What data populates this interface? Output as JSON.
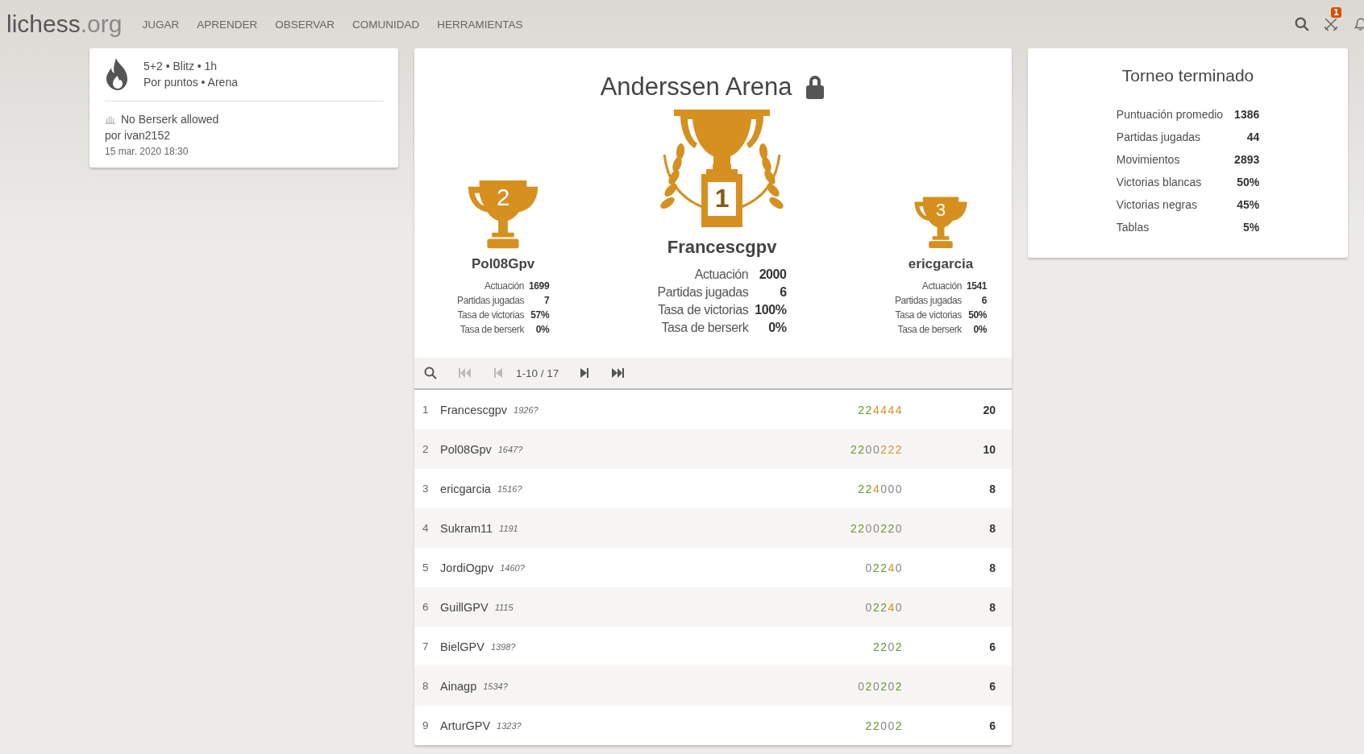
{
  "header": {
    "logo_main": "lichess",
    "logo_tld": ".org",
    "nav": [
      "JUGAR",
      "APRENDER",
      "OBSERVAR",
      "COMUNIDAD",
      "HERRAMIENTAS"
    ],
    "challenge_badge": "1"
  },
  "info": {
    "line1": "5+2 • Blitz • 1h",
    "line2": "Por puntos • Arena",
    "note": "No Berserk allowed",
    "author": "por ivan2152",
    "date": "15 mar. 2020 18:30"
  },
  "tournament": {
    "title": "Anderssen Arena",
    "locked": true
  },
  "podium": [
    {
      "place": "2",
      "name": "Pol08Gpv",
      "stats": [
        [
          "Actuación",
          "1699"
        ],
        [
          "Partidas jugadas",
          "7"
        ],
        [
          "Tasa de victorias",
          "57%"
        ],
        [
          "Tasa de berserk",
          "0%"
        ]
      ]
    },
    {
      "place": "1",
      "name": "Francescgpv",
      "stats": [
        [
          "Actuación",
          "2000"
        ],
        [
          "Partidas jugadas",
          "6"
        ],
        [
          "Tasa de victorias",
          "100%"
        ],
        [
          "Tasa de berserk",
          "0%"
        ]
      ]
    },
    {
      "place": "3",
      "name": "ericgarcia",
      "stats": [
        [
          "Actuación",
          "1541"
        ],
        [
          "Partidas jugadas",
          "6"
        ],
        [
          "Tasa de victorias",
          "50%"
        ],
        [
          "Tasa de berserk",
          "0%"
        ]
      ]
    }
  ],
  "pager": {
    "range": "1-10 / 17"
  },
  "standings": [
    {
      "rank": "1",
      "name": "Francescgpv",
      "rating": "1926?",
      "sheet": [
        {
          "d": "2",
          "kind": "win"
        },
        {
          "d": "2",
          "kind": "win"
        },
        {
          "d": "4",
          "kind": "streak"
        },
        {
          "d": "4",
          "kind": "streak"
        },
        {
          "d": "4",
          "kind": "streak"
        },
        {
          "d": "4",
          "kind": "streak"
        }
      ],
      "score": "20"
    },
    {
      "rank": "2",
      "name": "Pol08Gpv",
      "rating": "1647?",
      "sheet": [
        {
          "d": "2",
          "kind": "win"
        },
        {
          "d": "2",
          "kind": "win"
        },
        {
          "d": "0",
          "kind": "loss"
        },
        {
          "d": "0",
          "kind": "loss"
        },
        {
          "d": "2",
          "kind": "streak"
        },
        {
          "d": "2",
          "kind": "streak"
        },
        {
          "d": "2",
          "kind": "streak"
        }
      ],
      "score": "10"
    },
    {
      "rank": "3",
      "name": "ericgarcia",
      "rating": "1516?",
      "sheet": [
        {
          "d": "2",
          "kind": "win"
        },
        {
          "d": "2",
          "kind": "win"
        },
        {
          "d": "4",
          "kind": "streak"
        },
        {
          "d": "0",
          "kind": "loss"
        },
        {
          "d": "0",
          "kind": "loss"
        },
        {
          "d": "0",
          "kind": "loss"
        }
      ],
      "score": "8"
    },
    {
      "rank": "4",
      "name": "Sukram11",
      "rating": "1191",
      "sheet": [
        {
          "d": "2",
          "kind": "win"
        },
        {
          "d": "2",
          "kind": "win"
        },
        {
          "d": "0",
          "kind": "loss"
        },
        {
          "d": "0",
          "kind": "loss"
        },
        {
          "d": "2",
          "kind": "win"
        },
        {
          "d": "2",
          "kind": "win"
        },
        {
          "d": "0",
          "kind": "loss"
        }
      ],
      "score": "8"
    },
    {
      "rank": "5",
      "name": "JordiOgpv",
      "rating": "1460?",
      "sheet": [
        {
          "d": "0",
          "kind": "loss"
        },
        {
          "d": "2",
          "kind": "win"
        },
        {
          "d": "2",
          "kind": "win"
        },
        {
          "d": "4",
          "kind": "streak"
        },
        {
          "d": "0",
          "kind": "loss"
        }
      ],
      "score": "8"
    },
    {
      "rank": "6",
      "name": "GuillGPV",
      "rating": "1115",
      "sheet": [
        {
          "d": "0",
          "kind": "loss"
        },
        {
          "d": "2",
          "kind": "win"
        },
        {
          "d": "2",
          "kind": "win"
        },
        {
          "d": "4",
          "kind": "streak"
        },
        {
          "d": "0",
          "kind": "loss"
        }
      ],
      "score": "8"
    },
    {
      "rank": "7",
      "name": "BielGPV",
      "rating": "1398?",
      "sheet": [
        {
          "d": "2",
          "kind": "win"
        },
        {
          "d": "2",
          "kind": "win"
        },
        {
          "d": "0",
          "kind": "loss"
        },
        {
          "d": "2",
          "kind": "win"
        }
      ],
      "score": "6"
    },
    {
      "rank": "8",
      "name": "Ainagp",
      "rating": "1534?",
      "sheet": [
        {
          "d": "0",
          "kind": "loss"
        },
        {
          "d": "2",
          "kind": "win"
        },
        {
          "d": "0",
          "kind": "loss"
        },
        {
          "d": "2",
          "kind": "win"
        },
        {
          "d": "0",
          "kind": "loss"
        },
        {
          "d": "2",
          "kind": "win"
        }
      ],
      "score": "6"
    },
    {
      "rank": "9",
      "name": "ArturGPV",
      "rating": "1323?",
      "sheet": [
        {
          "d": "2",
          "kind": "win"
        },
        {
          "d": "2",
          "kind": "win"
        },
        {
          "d": "0",
          "kind": "loss"
        },
        {
          "d": "0",
          "kind": "loss"
        },
        {
          "d": "2",
          "kind": "win"
        }
      ],
      "score": "6"
    }
  ],
  "summary": {
    "title": "Torneo terminado",
    "rows": [
      [
        "Puntuación promedio",
        "1386"
      ],
      [
        "Partidas jugadas",
        "44"
      ],
      [
        "Movimientos",
        "2893"
      ],
      [
        "Victorias blancas",
        "50%"
      ],
      [
        "Victorias negras",
        "45%"
      ],
      [
        "Tablas",
        "5%"
      ]
    ]
  }
}
